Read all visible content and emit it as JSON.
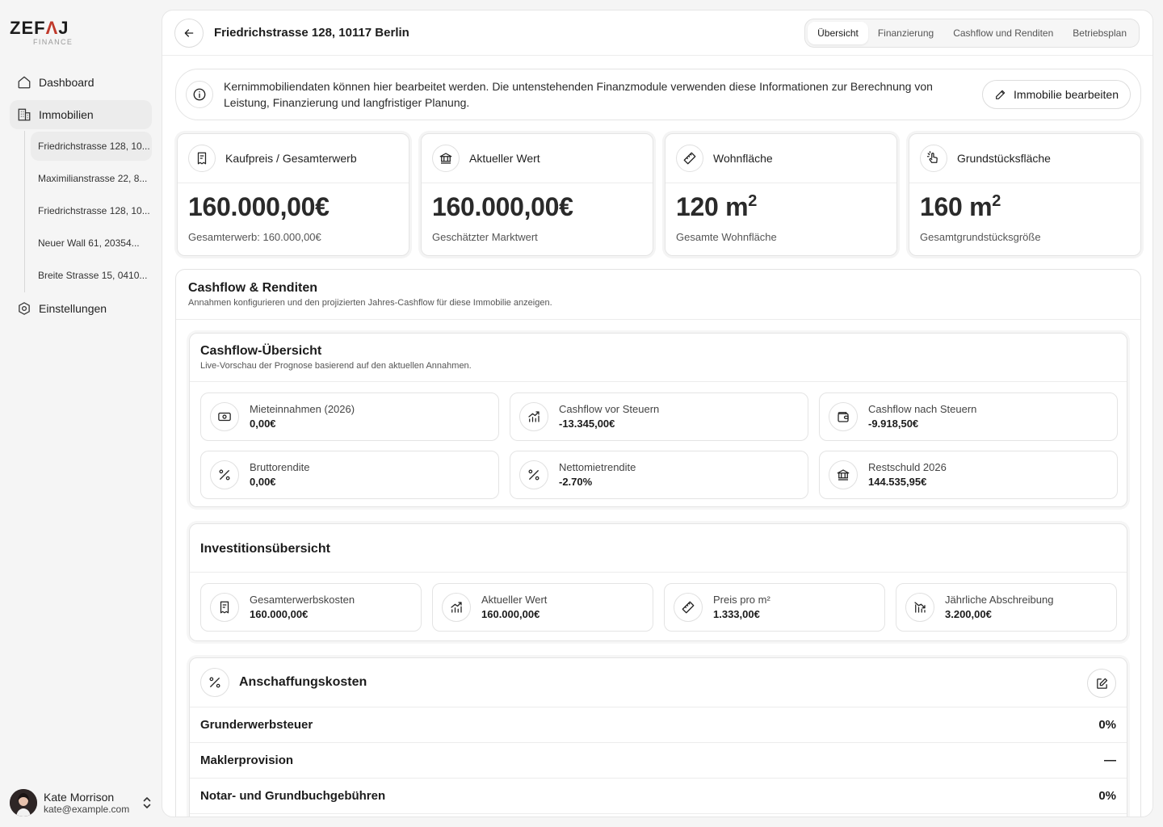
{
  "brand": {
    "name_part1": "ZEF",
    "name_accent": "Λ",
    "name_part2": "J",
    "sub": "FINANCE"
  },
  "sidebar": {
    "items": [
      {
        "label": "Dashboard",
        "icon": "home-icon"
      },
      {
        "label": "Immobilien",
        "icon": "building-icon"
      },
      {
        "label": "Einstellungen",
        "icon": "settings-icon"
      }
    ],
    "properties": [
      "Friedrichstrasse 128, 10...",
      "Maximilianstrasse 22, 8...",
      "Friedrichstrasse 128, 10...",
      "Neuer Wall 61, 20354...",
      "Breite Strasse 15, 0410..."
    ]
  },
  "user": {
    "name": "Kate Morrison",
    "email": "kate@example.com"
  },
  "header": {
    "title": "Friedrichstrasse 128, 10117 Berlin",
    "tabs": [
      "Übersicht",
      "Finanzierung",
      "Cashflow und Renditen",
      "Betriebsplan"
    ],
    "active_tab": "Übersicht"
  },
  "info": {
    "text": "Kernimmobiliendaten können hier bearbeitet werden. Die untenstehenden Finanzmodule verwenden diese Informationen zur Berechnung von Leistung, Finanzierung und langfristiger Planung.",
    "edit_label": "Immobilie bearbeiten"
  },
  "kpis": [
    {
      "label": "Kaufpreis / Gesamterwerb",
      "value": "160.000,00€",
      "sub": "Gesamterwerb: 160.000,00€",
      "icon": "receipt-icon"
    },
    {
      "label": "Aktueller Wert",
      "value": "160.000,00€",
      "sub": "Geschätzter Marktwert",
      "icon": "bank-icon"
    },
    {
      "label": "Wohnfläche",
      "value": "120 m",
      "value_sup": "2",
      "sub": "Gesamte Wohnfläche",
      "icon": "ruler-icon"
    },
    {
      "label": "Grundstücksfläche",
      "value": "160 m",
      "value_sup": "2",
      "sub": "Gesamtgrundstücksgröße",
      "icon": "touch-icon"
    }
  ],
  "cashflow_section": {
    "title": "Cashflow & Renditen",
    "subtitle": "Annahmen konfigurieren und den projizierten Jahres-Cashflow für diese Immobilie anzeigen."
  },
  "overview": {
    "title": "Cashflow-Übersicht",
    "subtitle": "Live-Vorschau der Prognose basierend auf den aktuellen Annahmen.",
    "items": [
      {
        "label": "Mieteinnahmen (2026)",
        "value": "0,00€",
        "icon": "banknote-icon"
      },
      {
        "label": "Cashflow vor Steuern",
        "value": "-13.345,00€",
        "icon": "chart-up-icon"
      },
      {
        "label": "Cashflow nach Steuern",
        "value": "-9.918,50€",
        "icon": "wallet-icon"
      },
      {
        "label": "Bruttorendite",
        "value": "0,00€",
        "icon": "percent-icon"
      },
      {
        "label": "Nettomietrendite",
        "value": "-2.70%",
        "icon": "percent-icon"
      },
      {
        "label": "Restschuld 2026",
        "value": "144.535,95€",
        "icon": "bank-icon"
      }
    ]
  },
  "investment": {
    "title": "Investitionsübersicht",
    "items": [
      {
        "label": "Gesamterwerbskosten",
        "value": "160.000,00€",
        "icon": "receipt-icon"
      },
      {
        "label": "Aktueller Wert",
        "value": "160.000,00€",
        "icon": "chart-up-icon"
      },
      {
        "label": "Preis pro m²",
        "value": "1.333,00€",
        "icon": "ruler-icon"
      },
      {
        "label": "Jährliche Abschreibung",
        "value": "3.200,00€",
        "icon": "chart-down-icon"
      }
    ]
  },
  "acquisition": {
    "title": "Anschaffungskosten",
    "rows": [
      {
        "label": "Grunderwerbsteuer",
        "value": "0%"
      },
      {
        "label": "Maklerprovision",
        "value": "—"
      },
      {
        "label": "Notar- und Grundbuchgebühren",
        "value": "0%"
      }
    ]
  }
}
